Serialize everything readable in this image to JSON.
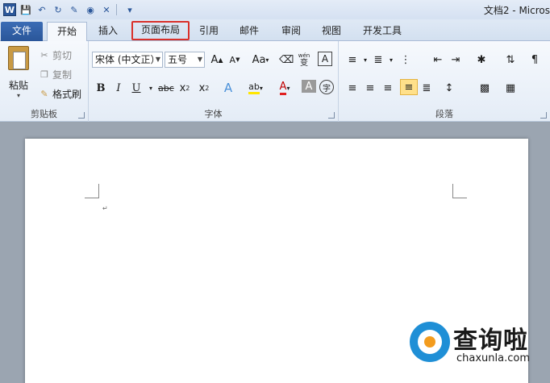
{
  "window": {
    "title": "文档2 - Micros"
  },
  "quick_access": {
    "icons": [
      "word-logo",
      "save-icon",
      "undo-icon",
      "redo-icon",
      "format-painter-icon",
      "color-icon",
      "eraser-icon",
      "customize-icon"
    ]
  },
  "tabs": [
    {
      "label": "文件"
    },
    {
      "label": "开始"
    },
    {
      "label": "插入"
    },
    {
      "label": "页面布局"
    },
    {
      "label": "引用"
    },
    {
      "label": "邮件"
    },
    {
      "label": "审阅"
    },
    {
      "label": "视图"
    },
    {
      "label": "开发工具"
    }
  ],
  "clipboard": {
    "paste": "粘贴",
    "cut": "剪切",
    "copy": "复制",
    "format_painter": "格式刷",
    "label": "剪贴板"
  },
  "font": {
    "name": "宋体 (中文正）",
    "size": "五号",
    "label": "字体",
    "aa": "Aa",
    "wen": "wén",
    "bian": "变",
    "zi": "字"
  },
  "paragraph": {
    "label": "段落"
  },
  "watermark": {
    "brand": "查询啦",
    "url": "chaxunla.com"
  },
  "colors": {
    "accent": "#2b579a",
    "highlight_border": "#d9302a",
    "file_tab": "#2a5699"
  }
}
